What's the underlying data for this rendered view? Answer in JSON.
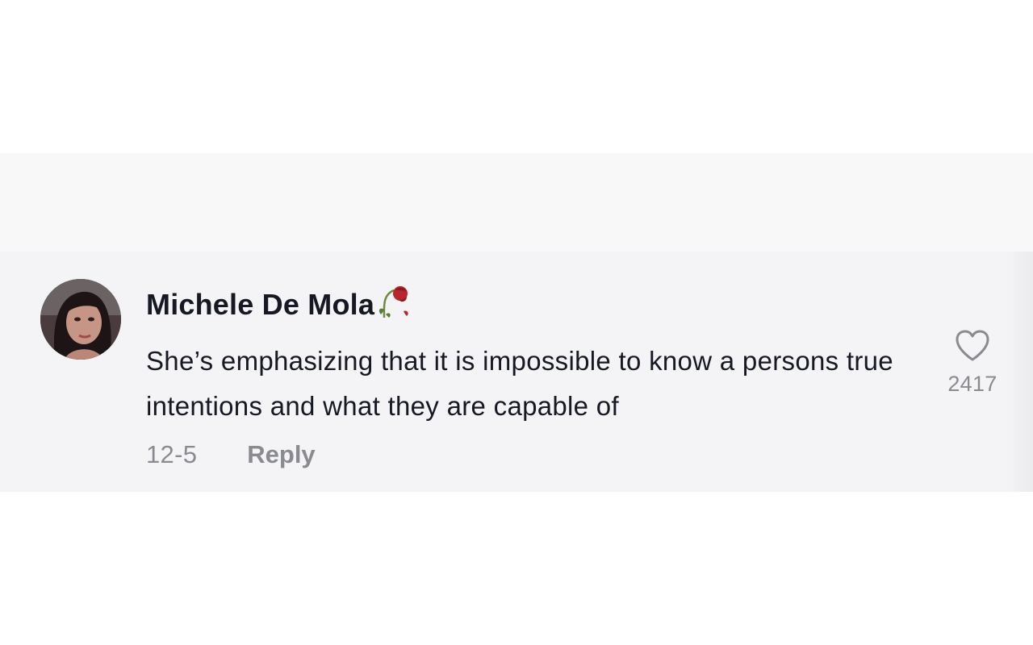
{
  "comment": {
    "username": "Michele De Mola",
    "username_emoji": "wilted-flower-icon",
    "text": "She’s emphasizing that it is impossible to know a persons true intentions and what they are capable of",
    "date": "12-5",
    "reply_label": "Reply",
    "like_count": "2417"
  },
  "colors": {
    "primary_text": "#161823",
    "secondary_text": "#8a8b91",
    "card_background": "#f4f4f6",
    "rose_red": "#b8252a"
  }
}
